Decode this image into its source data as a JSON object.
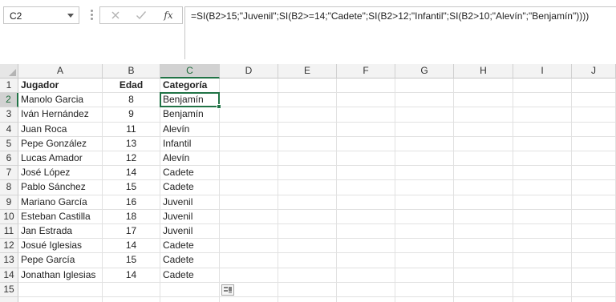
{
  "formula_bar": {
    "name_box": "C2",
    "fx_label": "fx",
    "formula": "=SI(B2>15;\"Juvenil\";SI(B2>=14;\"Cadete\";SI(B2>12;\"Infantil\";SI(B2>10;\"Alevín\";\"Benjamín\"))))"
  },
  "sheet": {
    "columns": [
      "A",
      "B",
      "C",
      "D",
      "E",
      "F",
      "G",
      "H",
      "I",
      "J"
    ],
    "selected_column": "C",
    "selected_row": 2,
    "active_cell": "C2",
    "rows": [
      [
        "Jugador",
        "Edad",
        "Categoría"
      ],
      [
        "Manolo Garcia",
        "8",
        "Benjamín"
      ],
      [
        "Iván Hernández",
        "9",
        "Benjamín"
      ],
      [
        "Juan Roca",
        "11",
        "Alevín"
      ],
      [
        "Pepe González",
        "13",
        "Infantil"
      ],
      [
        "Lucas Amador",
        "12",
        "Alevín"
      ],
      [
        "José López",
        "14",
        "Cadete"
      ],
      [
        "Pablo Sánchez",
        "15",
        "Cadete"
      ],
      [
        "Mariano García",
        "16",
        "Juvenil"
      ],
      [
        "Esteban Castilla",
        "18",
        "Juvenil"
      ],
      [
        "Jan Estrada",
        "17",
        "Juvenil"
      ],
      [
        "Josué Iglesias",
        "14",
        "Cadete"
      ],
      [
        "Pepe García",
        "15",
        "Cadete"
      ],
      [
        "Jonathan Iglesias",
        "14",
        "Cadete"
      ]
    ],
    "row_numbers": [
      "1",
      "2",
      "3",
      "4",
      "5",
      "6",
      "7",
      "8",
      "9",
      "10",
      "11",
      "12",
      "13",
      "14",
      "15"
    ]
  },
  "colors": {
    "accent": "#217346",
    "header_bg": "#f3f3f3",
    "header_selected_bg": "#d2d2d2",
    "gridline": "#e1e1e1"
  }
}
